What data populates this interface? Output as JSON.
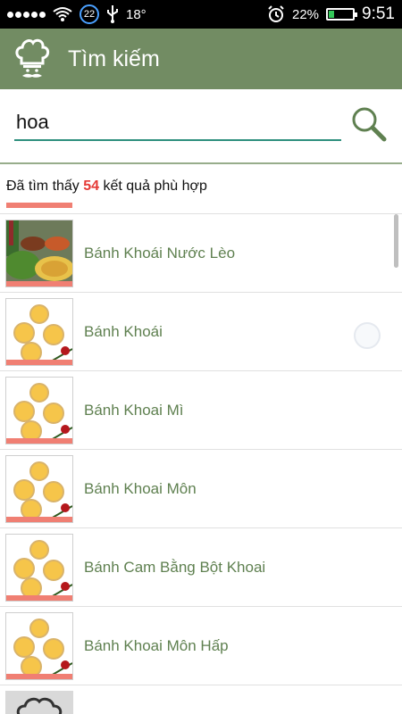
{
  "status_bar": {
    "badge": "22",
    "temperature": "18°",
    "battery_percent": "22%",
    "battery_level": 0.22,
    "time": "9:51",
    "icons": [
      "signal-dots-icon",
      "wifi-icon",
      "usb-icon",
      "alarm-clock-icon",
      "battery-icon"
    ]
  },
  "app_bar": {
    "title": "Tìm kiếm",
    "icon": "chef-hat-icon",
    "color": "#728c63"
  },
  "search": {
    "value": "hoa",
    "icon": "search-icon"
  },
  "results": {
    "prefix": "Đã tìm thấy ",
    "count": "54",
    "suffix": " kết quả phù hợp",
    "items": [
      {
        "label": "Bánh Khoái Nước Lèo"
      },
      {
        "label": "Bánh Khoái"
      },
      {
        "label": "Bánh Khoai Mì"
      },
      {
        "label": "Bánh Khoai Môn"
      },
      {
        "label": "Bánh Cam Bằng Bột Khoai"
      },
      {
        "label": "Bánh Khoai Môn Hấp"
      }
    ]
  },
  "colors": {
    "accent": "#2e8f7e",
    "highlight": "#e53935",
    "underline": "#f07f73",
    "item_text": "#5f8050"
  }
}
